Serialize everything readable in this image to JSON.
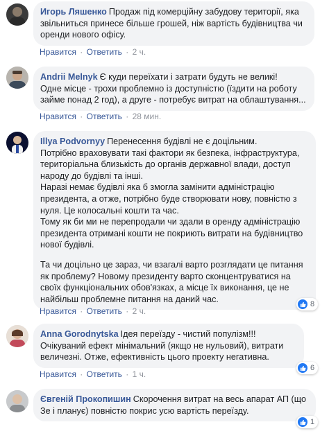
{
  "labels": {
    "like": "Нравится",
    "reply": "Ответить",
    "sep": "·"
  },
  "comments": [
    {
      "author": "Игорь Ляшенко",
      "lines": [
        "Продаж під комерційну забудову території, яка",
        "звільниться принесе більше грошей, ніж вартість будівництва чи",
        "оренди нового офісу."
      ],
      "time": "2 ч."
    },
    {
      "author": "Andrii Melnyk",
      "lines": [
        "Є куди переїхати і затрати будуть не великі!",
        "Одне місце - трохи проблемно із доступністю (їздити на роботу",
        "займе понад 2 год), а друге - потребує витрат на облаштування..."
      ],
      "time": "28 мин."
    },
    {
      "author": "Illya Podvornyy",
      "lines": [
        "Перенесення будівлі не є доцільним.",
        "Потрібно враховувати такі фактори як безпека, інфраструктура,",
        "територіальна близькість до органів державної влади, доступ",
        "народу до будівлі та інші.",
        "Наразі немає будівлі яка б змогла замінити адміністрацію",
        "президента, а отже, потрібно буде створювати нову, повністю з",
        "нуля. Це колосальні кошти та час.",
        "Тому як би ми не перепродали чи здали в оренду адміністрацію",
        "президента отримані кошти не покриють витрати на будівництво",
        "нової будівлі."
      ],
      "lines2": [
        "Та чи доцільно це зараз, чи взагалі варто розглядати це питання",
        "як проблему? Новому президенту варто сконцентруватися на",
        "своїх функціональних обов'язках, а місце їх виконання, це не",
        "найбільш проблемне питання на даний час."
      ],
      "time": "2 ч.",
      "reactions": "8"
    },
    {
      "author": "Anna Gorodnytska",
      "lines": [
        "Ідея переїзду - чистий популізм!!!",
        "Очікуваний ефект мінімальний (якщо не нульовий), витрати",
        "величезні. Отже, ефективність цього проекту негативна."
      ],
      "time": "1 ч.",
      "reactions": "6"
    },
    {
      "author": "Євгеній Прокопишин",
      "lines": [
        "Скорочення витрат на весь апарат АП (що",
        "Зе і планує) повністю покрис усю вартість переїзду."
      ],
      "reactions": "1"
    }
  ],
  "colors": {
    "author": "#385898",
    "bubble": "#f2f3f5",
    "like": "#2078f4"
  }
}
